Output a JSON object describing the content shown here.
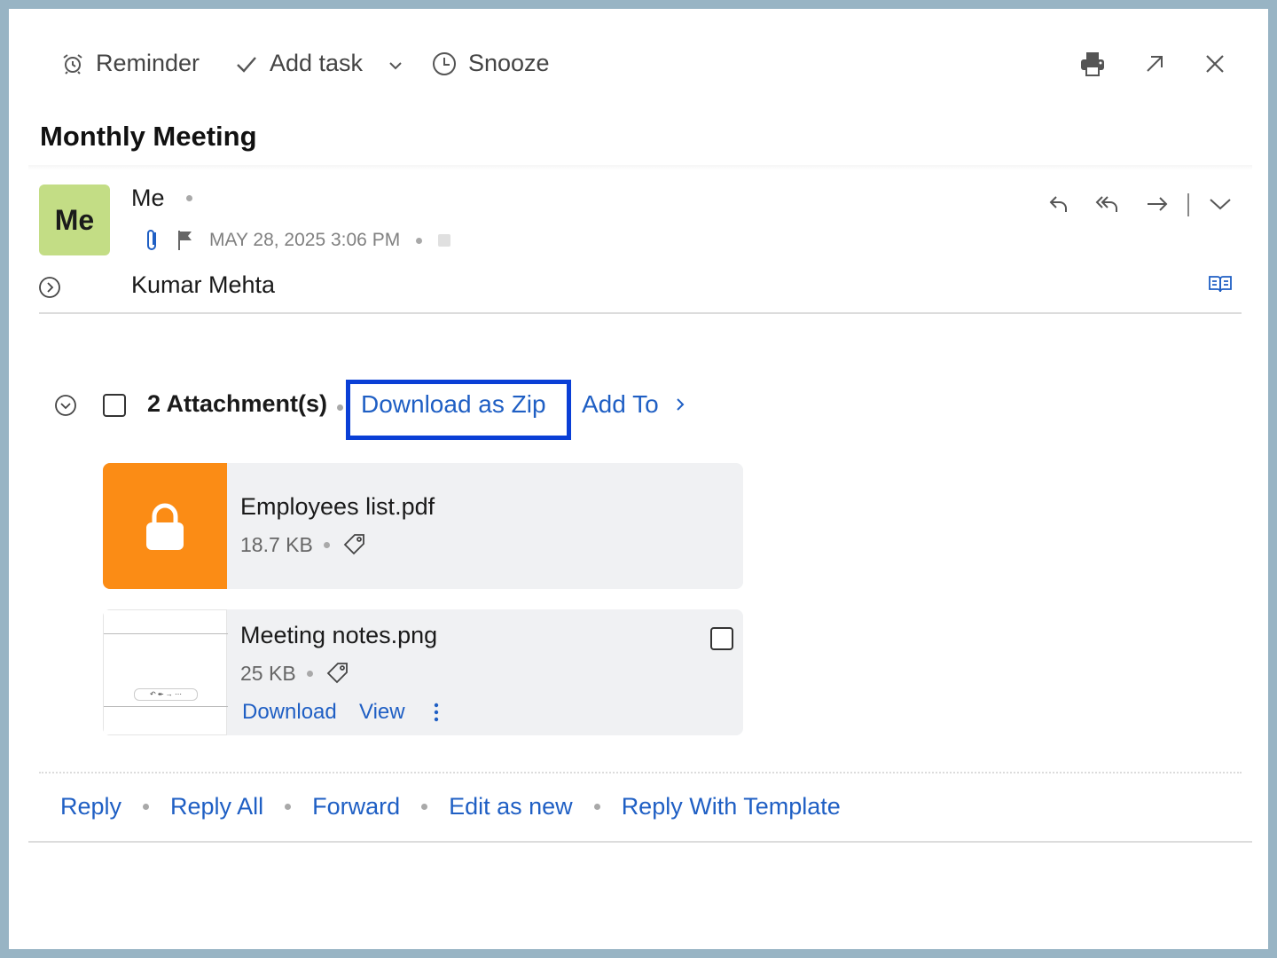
{
  "toolbar": {
    "reminder": "Reminder",
    "add_task": "Add task",
    "snooze": "Snooze"
  },
  "mail": {
    "subject": "Monthly Meeting",
    "avatar_initials": "Me",
    "sender": "Me",
    "date": "MAY 28, 2025 3:06 PM",
    "recipient": "Kumar Mehta"
  },
  "attachments": {
    "count_label": "2 Attachment(s)",
    "download_zip": "Download as Zip",
    "add_to": "Add To",
    "files": [
      {
        "name": "Employees list.pdf",
        "size": "18.7 KB",
        "thumb_icon": "lock-icon"
      },
      {
        "name": "Meeting notes.png",
        "size": "25 KB",
        "download": "Download",
        "view": "View"
      }
    ]
  },
  "footer": {
    "reply": "Reply",
    "reply_all": "Reply All",
    "forward": "Forward",
    "edit_as_new": "Edit as new",
    "reply_template": "Reply With Template"
  },
  "colors": {
    "accent_link": "#1f5fc4",
    "highlight_box": "#0a3fd6",
    "avatar_bg": "#c3dd85",
    "pdf_thumb": "#fb8c15",
    "frame_border": "#98b4c4"
  }
}
